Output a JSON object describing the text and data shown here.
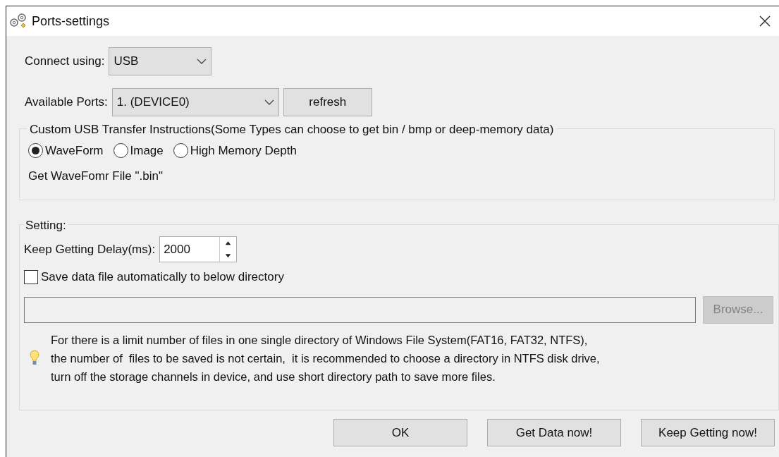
{
  "window": {
    "title": "Ports-settings"
  },
  "connect": {
    "label": "Connect using:",
    "value": "USB"
  },
  "ports": {
    "label": "Available Ports:",
    "value": "1. (DEVICE0)",
    "button": "refresh"
  },
  "transfer": {
    "legend": "Custom USB Transfer Instructions(Some Types can choose to get bin / bmp or deep-memory data)",
    "options": [
      {
        "label": "WaveForm",
        "selected": true
      },
      {
        "label": "Image",
        "selected": false
      },
      {
        "label": "High Memory Depth",
        "selected": false
      }
    ],
    "note": "Get WaveFomr File \".bin\""
  },
  "setting": {
    "legend": "Setting:",
    "delay_label": "Keep Getting Delay(ms):",
    "delay_value": "2000",
    "auto_save": {
      "label": "Save data file automatically to below directory",
      "checked": false
    },
    "browse": {
      "label": "Browse...",
      "disabled": true
    },
    "hint_lines": [
      "For there is a limit number of files in one single directory of Windows File System(FAT16, FAT32, NTFS),",
      "the number of  files to be saved is not certain,  it is recommended to choose a directory in NTFS disk drive,",
      "turn off the storage channels in device, and use short directory path to save more files."
    ]
  },
  "buttons": [
    "OK",
    "Get Data now!",
    "Keep Getting now!"
  ]
}
